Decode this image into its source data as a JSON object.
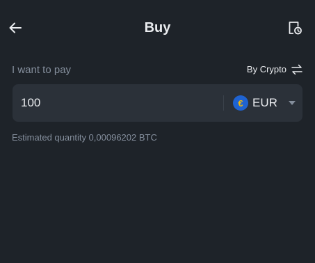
{
  "header": {
    "title": "Buy",
    "back_icon": "arrow-left-icon",
    "history_icon": "order-history-icon"
  },
  "form": {
    "pay_label": "I want to pay",
    "mode_label": "By Crypto",
    "mode_icon": "swap-icon",
    "amount_value": "100",
    "currency": {
      "code": "EUR",
      "symbol": "€",
      "icon": "euro-coin-icon"
    },
    "estimate_text": "Estimated quantity 0,00096202 BTC"
  },
  "colors": {
    "background": "#1e2329",
    "card": "#2b3139",
    "text_primary": "#eaecef",
    "text_secondary": "#848e9c",
    "coin_blue": "#1f63d1",
    "coin_symbol": "#f0b90b"
  }
}
